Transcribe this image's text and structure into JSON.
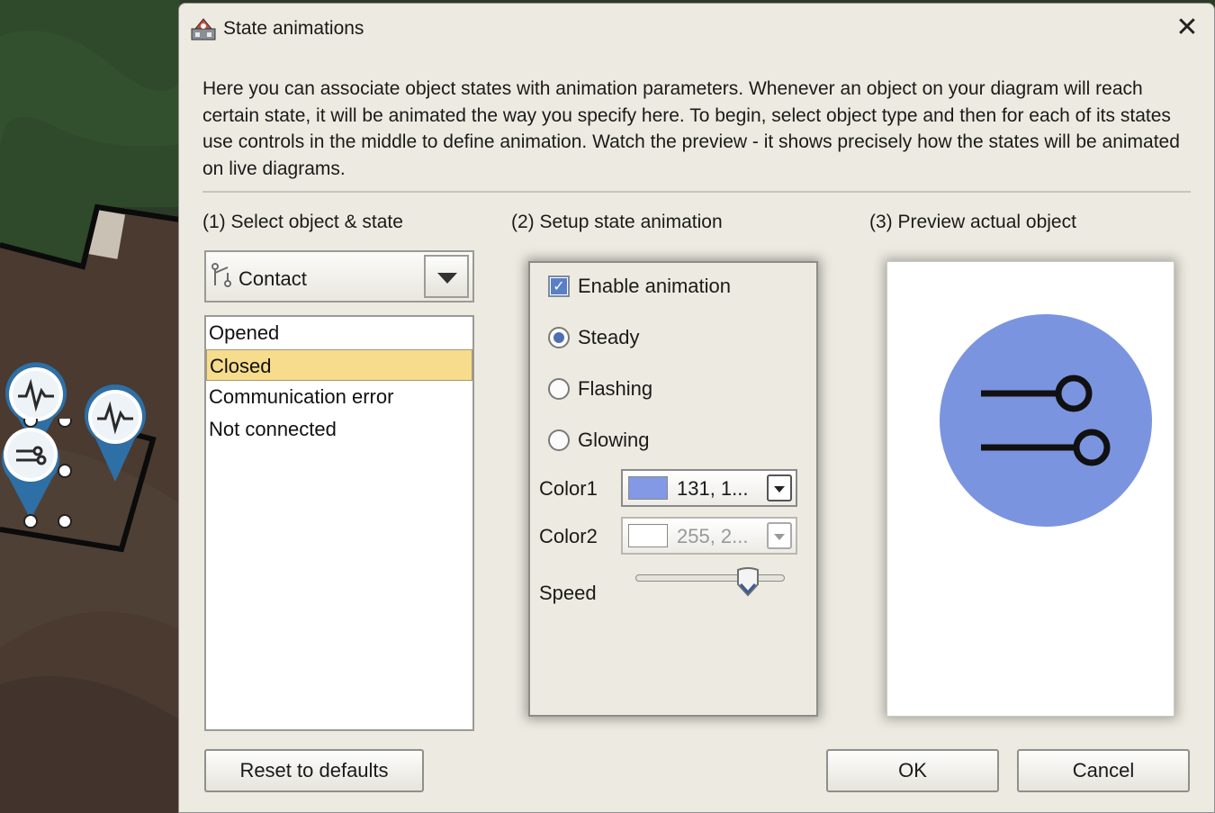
{
  "dialog": {
    "title": "State animations",
    "close_symbol": "✕",
    "intro": "Here you can associate object states with animation parameters. Whenever an object on your diagram will reach certain state, it will be animated the way you specify here. To begin, select object type and then for each of its states use controls in the middle to define animation. Watch the preview - it shows precisely how the states will be animated on live diagrams."
  },
  "sections": {
    "select_label": "(1) Select object & state",
    "setup_label": "(2) Setup state animation",
    "preview_label": "(3) Preview actual object"
  },
  "object_select": {
    "value": "Contact",
    "icon": "contact-icon"
  },
  "states": [
    {
      "label": "Opened",
      "selected": false
    },
    {
      "label": "Closed",
      "selected": true
    },
    {
      "label": "Communication error",
      "selected": false
    },
    {
      "label": "Not connected",
      "selected": false
    }
  ],
  "animation": {
    "enable_label": "Enable animation",
    "enabled": true,
    "modes": [
      {
        "label": "Steady",
        "checked": true
      },
      {
        "label": "Flashing",
        "checked": false
      },
      {
        "label": "Glowing",
        "checked": false
      }
    ],
    "color1": {
      "label": "Color1",
      "text": "131, 1...",
      "swatch": "#8399e6",
      "enabled": true
    },
    "color2": {
      "label": "Color2",
      "text": "255, 2...",
      "swatch": "#ffffff",
      "enabled": false
    },
    "speed": {
      "label": "Speed",
      "value": 0.75
    }
  },
  "preview": {
    "circle_color": "#7b94e0",
    "icon": "switch-contacts-icon"
  },
  "buttons": {
    "reset": "Reset to defaults",
    "ok": "OK",
    "cancel": "Cancel"
  }
}
